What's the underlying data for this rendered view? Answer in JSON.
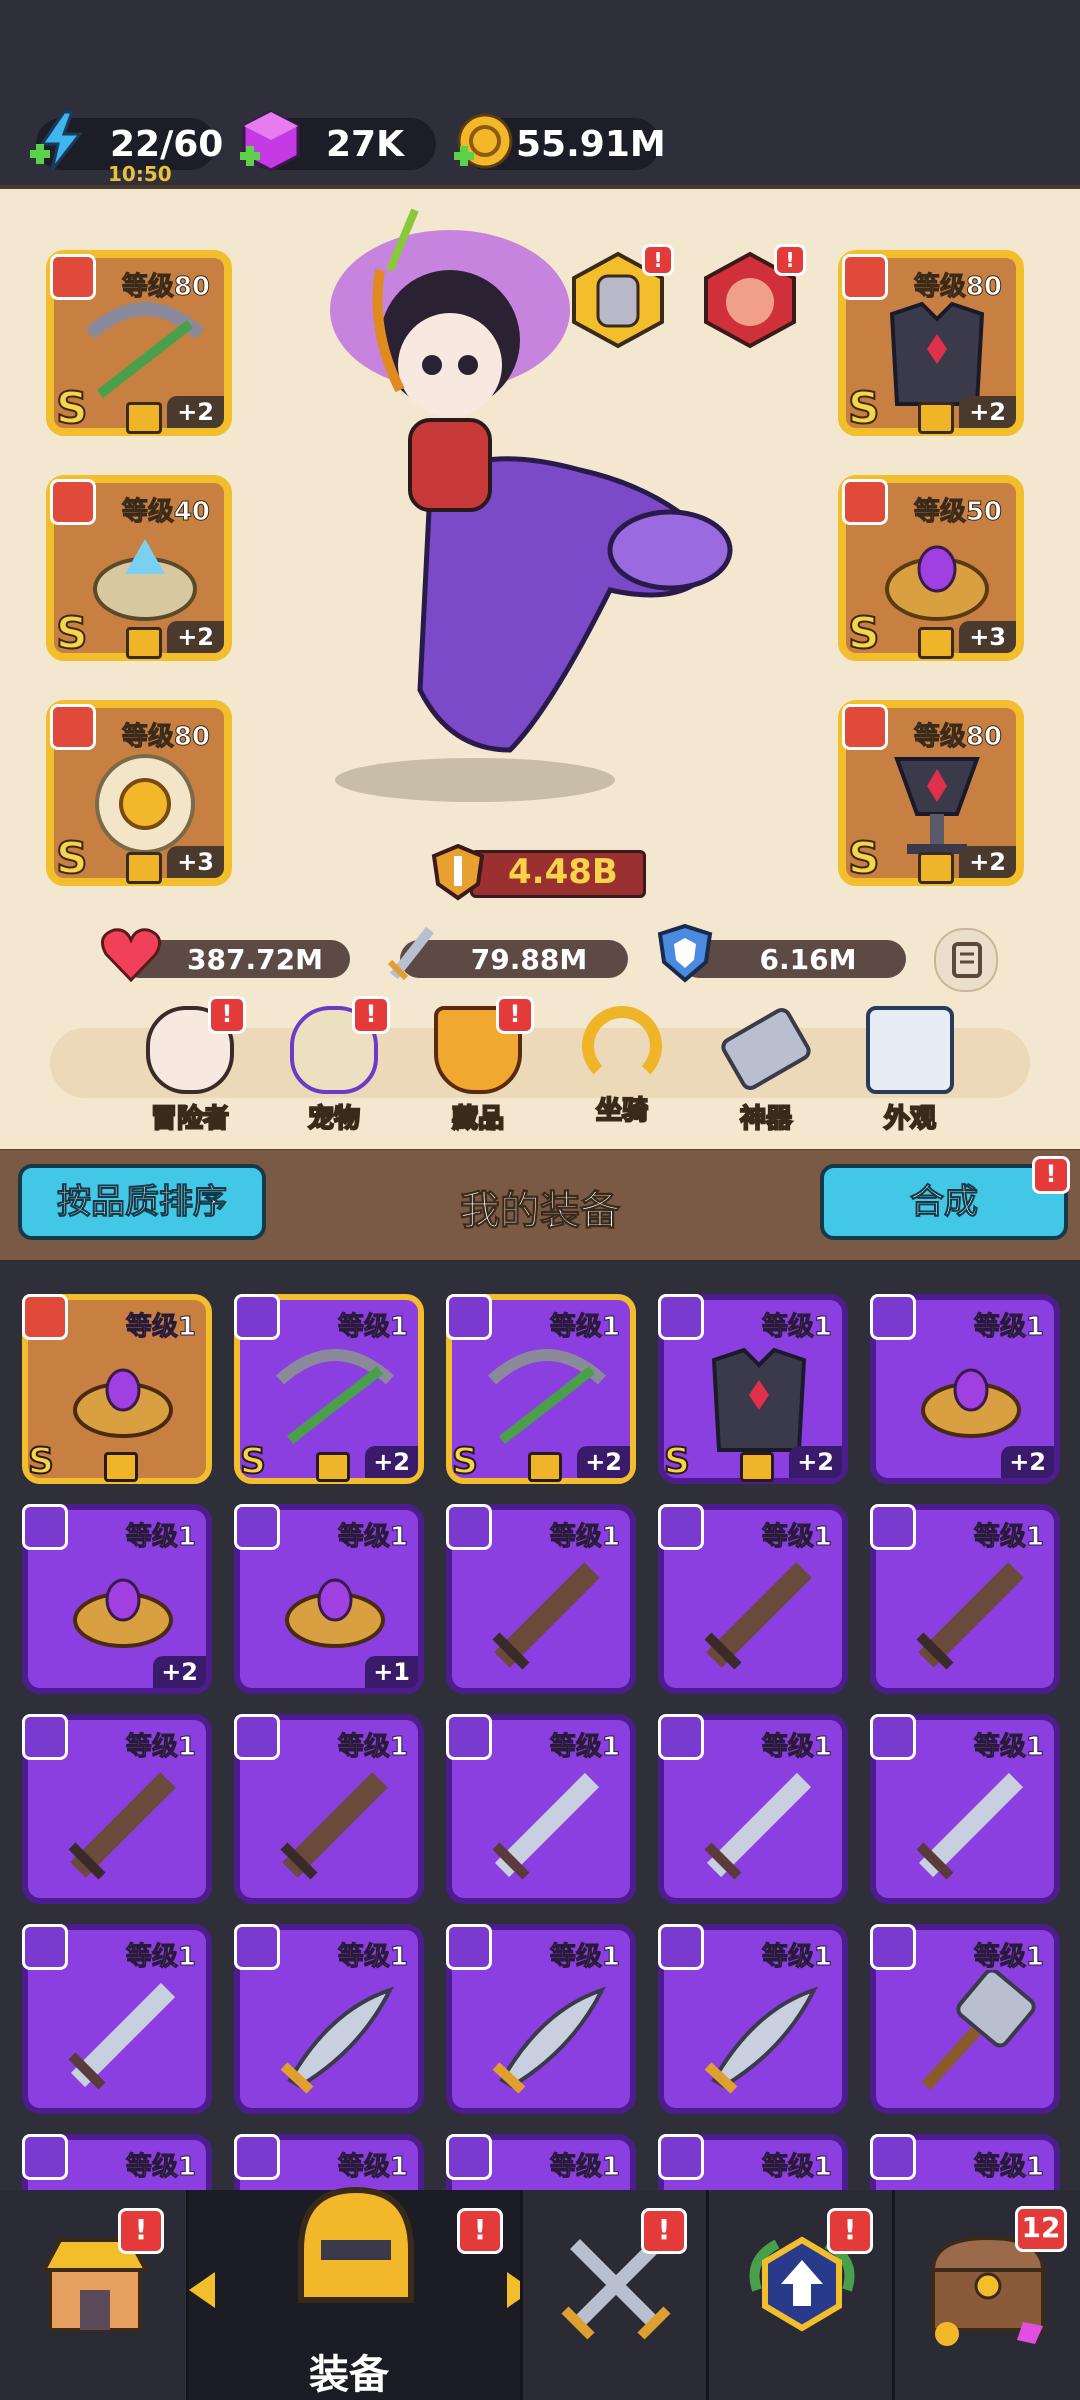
{
  "resources": {
    "energy": "22/60",
    "energy_timer": "10:50",
    "gems": "27K",
    "gold": "55.91M"
  },
  "hero": {
    "power": "4.48B",
    "stats": {
      "hp": "387.72M",
      "attack": "79.88M",
      "defense": "6.16M"
    },
    "left_slots": [
      {
        "level": "等级80",
        "grade": "S",
        "plus": "+2",
        "icon": "crossbow-icon"
      },
      {
        "level": "等级40",
        "grade": "S",
        "plus": "+2",
        "icon": "crystal-ring-icon"
      },
      {
        "level": "等级80",
        "grade": "S",
        "plus": "+3",
        "icon": "sun-medallion-icon"
      }
    ],
    "right_slots": [
      {
        "level": "等级80",
        "grade": "S",
        "plus": "+2",
        "icon": "dark-armor-icon"
      },
      {
        "level": "等级50",
        "grade": "S",
        "plus": "+3",
        "icon": "amethyst-ring-icon"
      },
      {
        "level": "等级80",
        "grade": "S",
        "plus": "+2",
        "icon": "ruby-chalice-icon"
      }
    ]
  },
  "menu": [
    {
      "label": "冒险者",
      "badge": "!"
    },
    {
      "label": "宠物",
      "badge": "!"
    },
    {
      "label": "藏品",
      "badge": "!"
    },
    {
      "label": "坐骑",
      "badge": ""
    },
    {
      "label": "神器",
      "badge": ""
    },
    {
      "label": "外观",
      "badge": ""
    }
  ],
  "equipment": {
    "sort_button": "按品质排序",
    "title": "我的装备",
    "merge_button": "合成",
    "merge_badge": "!",
    "items": [
      {
        "level": "等级1",
        "grade": "S",
        "plus": "",
        "style": "gold",
        "icon": "ring-icon"
      },
      {
        "level": "等级1",
        "grade": "S",
        "plus": "+2",
        "style": "purple-gold",
        "icon": "crossbow-icon"
      },
      {
        "level": "等级1",
        "grade": "S",
        "plus": "+2",
        "style": "purple-gold",
        "icon": "crossbow-icon"
      },
      {
        "level": "等级1",
        "grade": "S",
        "plus": "+2",
        "style": "purple",
        "icon": "armor-icon"
      },
      {
        "level": "等级1",
        "grade": "",
        "plus": "+2",
        "style": "purple",
        "icon": "ring-icon"
      },
      {
        "level": "等级1",
        "grade": "",
        "plus": "+2",
        "style": "purple",
        "icon": "ring-icon"
      },
      {
        "level": "等级1",
        "grade": "",
        "plus": "+1",
        "style": "purple",
        "icon": "ring-icon"
      },
      {
        "level": "等级1",
        "grade": "",
        "plus": "",
        "style": "purple",
        "icon": "wood-sword-icon"
      },
      {
        "level": "等级1",
        "grade": "",
        "plus": "",
        "style": "purple",
        "icon": "wood-sword-icon"
      },
      {
        "level": "等级1",
        "grade": "",
        "plus": "",
        "style": "purple",
        "icon": "wood-sword-icon"
      },
      {
        "level": "等级1",
        "grade": "",
        "plus": "",
        "style": "purple",
        "icon": "wood-sword-icon"
      },
      {
        "level": "等级1",
        "grade": "",
        "plus": "",
        "style": "purple",
        "icon": "wood-sword-icon"
      },
      {
        "level": "等级1",
        "grade": "",
        "plus": "",
        "style": "purple",
        "icon": "steel-sword-icon"
      },
      {
        "level": "等级1",
        "grade": "",
        "plus": "",
        "style": "purple",
        "icon": "steel-sword-icon"
      },
      {
        "level": "等级1",
        "grade": "",
        "plus": "",
        "style": "purple",
        "icon": "steel-sword-icon"
      },
      {
        "level": "等级1",
        "grade": "",
        "plus": "",
        "style": "purple",
        "icon": "steel-sword-icon"
      },
      {
        "level": "等级1",
        "grade": "",
        "plus": "",
        "style": "purple",
        "icon": "scimitar-icon"
      },
      {
        "level": "等级1",
        "grade": "",
        "plus": "",
        "style": "purple",
        "icon": "scimitar-icon"
      },
      {
        "level": "等级1",
        "grade": "",
        "plus": "",
        "style": "purple",
        "icon": "scimitar-icon"
      },
      {
        "level": "等级1",
        "grade": "",
        "plus": "",
        "style": "purple",
        "icon": "hammer-icon"
      },
      {
        "level": "等级1",
        "grade": "",
        "plus": "",
        "style": "purple",
        "icon": "sword-icon"
      },
      {
        "level": "等级1",
        "grade": "",
        "plus": "",
        "style": "purple",
        "icon": "sword-icon"
      },
      {
        "level": "等级1",
        "grade": "",
        "plus": "",
        "style": "purple",
        "icon": "sword-icon"
      },
      {
        "level": "等级1",
        "grade": "",
        "plus": "",
        "style": "purple",
        "icon": "sword-icon"
      },
      {
        "level": "等级1",
        "grade": "",
        "plus": "",
        "style": "purple",
        "icon": "sword-icon"
      }
    ]
  },
  "nav": {
    "tabs": [
      {
        "name": "shop",
        "badge": "!"
      },
      {
        "name": "equipment",
        "label": "装备",
        "badge": "!"
      },
      {
        "name": "battle",
        "badge": "!"
      },
      {
        "name": "upgrade",
        "badge": "!"
      },
      {
        "name": "treasure",
        "badge": "12"
      }
    ]
  },
  "colors": {
    "gold_frame": "#f2be2c",
    "purple_slot": "#8b3fe0",
    "orange_slot": "#c87f42",
    "cyan_button": "#42c8e6",
    "alert_red": "#e53a3a"
  }
}
